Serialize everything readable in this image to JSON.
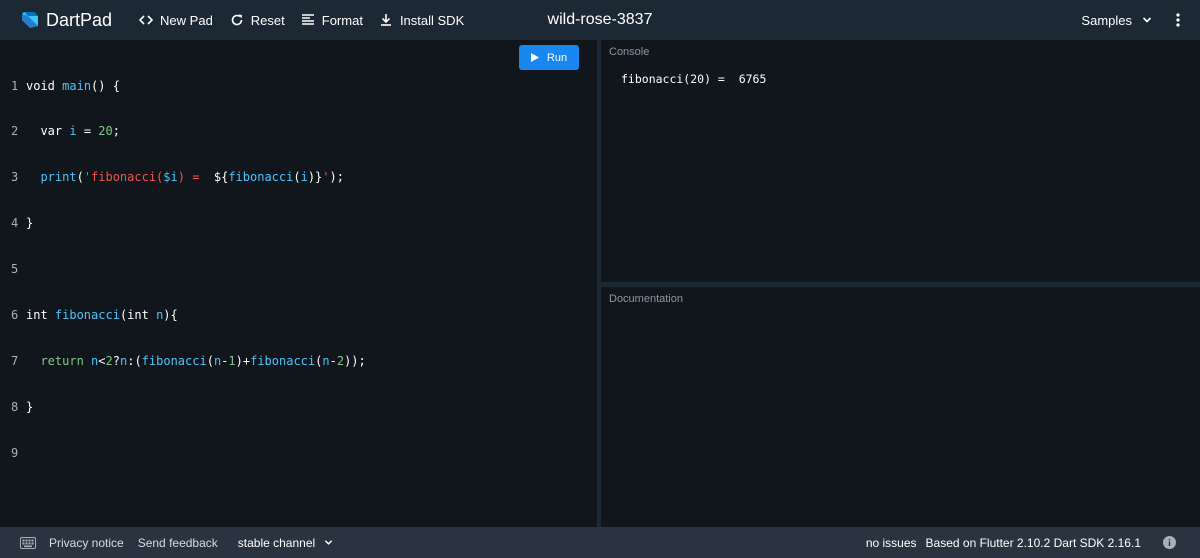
{
  "header": {
    "brand": "DartPad",
    "new_pad": "New Pad",
    "reset": "Reset",
    "format": "Format",
    "install_sdk": "Install SDK",
    "title": "wild-rose-3837",
    "samples": "Samples"
  },
  "editor": {
    "run_label": "Run",
    "line_numbers": [
      "1",
      "2",
      "3",
      "4",
      "5",
      "6",
      "7",
      "8",
      "9"
    ],
    "lines": {
      "l1": [
        "void",
        " ",
        "main",
        "() {"
      ],
      "l2": [
        "  var ",
        "i",
        " = ",
        "20",
        ";"
      ],
      "l3": [
        "  ",
        "print",
        "(",
        "'fibonacci(",
        "$i",
        ") =  ",
        "${",
        "fibonacci",
        "(",
        "i",
        ")}",
        "'",
        ");"
      ],
      "l4": [
        "}"
      ],
      "l5": [
        ""
      ],
      "l6": [
        "int ",
        "fibonacci",
        "(int ",
        "n",
        "){"
      ],
      "l7": [
        "  ",
        "return",
        " ",
        "n",
        "<",
        "2",
        "?",
        "n",
        ":(",
        "fibonacci",
        "(",
        "n",
        "-",
        "1",
        ")+",
        "fibonacci",
        "(",
        "n",
        "-",
        "2",
        "));"
      ],
      "l8": [
        "}"
      ],
      "l9": [
        ""
      ]
    }
  },
  "console": {
    "title": "Console",
    "output": "fibonacci(20) =  6765"
  },
  "docs": {
    "title": "Documentation"
  },
  "footer": {
    "privacy": "Privacy notice",
    "feedback": "Send feedback",
    "channel": "stable channel",
    "issues": "no issues",
    "sdk": "Based on Flutter 2.10.2 Dart SDK 2.16.1"
  },
  "colors": {
    "chrome": "#1c2834",
    "panel": "#11161c",
    "footer": "#2a3440",
    "run_button": "#1a86f0",
    "keyword": "#ffffff",
    "function": "#4fc3f7",
    "number": "#81c784",
    "string": "#ef5350"
  },
  "icons": {
    "brand": "dart-logo-icon",
    "new_pad": "code-brackets-icon",
    "reset": "refresh-icon",
    "format": "format-lines-icon",
    "install_sdk": "download-icon",
    "samples": "chevron-down-icon",
    "more": "more-vertical-icon",
    "run": "play-icon",
    "keyboard": "keyboard-icon",
    "channel": "chevron-down-icon",
    "info": "info-icon"
  }
}
